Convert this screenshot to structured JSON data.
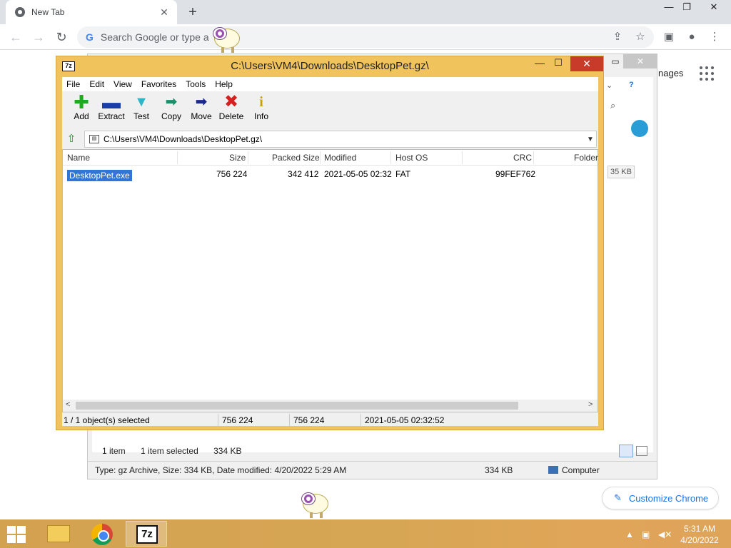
{
  "chrome": {
    "tab_title": "New Tab",
    "omnibox_placeholder": "Search Google or type a URL",
    "omnibox_visible": "Search Google or type a",
    "images_link": "nages",
    "customize_label": "Customize Chrome"
  },
  "explorer": {
    "items_count": "1 item",
    "selected_info": "1 item selected",
    "selected_size": "334 KB",
    "type_info": "Type: gz Archive, Size: 334 KB, Date modified: 4/20/2022 5:29 AM",
    "status_size": "334 KB",
    "status_location": "Computer",
    "size_hint": "35 KB"
  },
  "sevenzip": {
    "title": "C:\\Users\\VM4\\Downloads\\DesktopPet.gz\\",
    "menu": [
      "File",
      "Edit",
      "View",
      "Favorites",
      "Tools",
      "Help"
    ],
    "tools": [
      {
        "label": "Add",
        "icon": "add-icon"
      },
      {
        "label": "Extract",
        "icon": "extract-icon"
      },
      {
        "label": "Test",
        "icon": "test-icon"
      },
      {
        "label": "Copy",
        "icon": "copy-icon"
      },
      {
        "label": "Move",
        "icon": "move-icon"
      },
      {
        "label": "Delete",
        "icon": "delete-icon"
      },
      {
        "label": "Info",
        "icon": "info-icon"
      }
    ],
    "path": "C:\\Users\\VM4\\Downloads\\DesktopPet.gz\\",
    "columns": [
      "Name",
      "Size",
      "Packed Size",
      "Modified",
      "Host OS",
      "CRC",
      "Folder"
    ],
    "rows": [
      {
        "name": "DesktopPet.exe",
        "size": "756 224",
        "packed": "342 412",
        "modified": "2021-05-05 02:32",
        "host": "FAT",
        "crc": "99FEF762"
      }
    ],
    "status": {
      "selected": "1 / 1 object(s) selected",
      "size": "756 224",
      "packed": "756 224",
      "modified": "2021-05-05 02:32:52"
    }
  },
  "taskbar": {
    "time": "5:31 AM",
    "date": "4/20/2022"
  },
  "colors": {
    "sevenzip_frame": "#f0c35c",
    "selection": "#3375d6",
    "close_red": "#c83b2b",
    "chrome_link": "#1a73e8"
  }
}
